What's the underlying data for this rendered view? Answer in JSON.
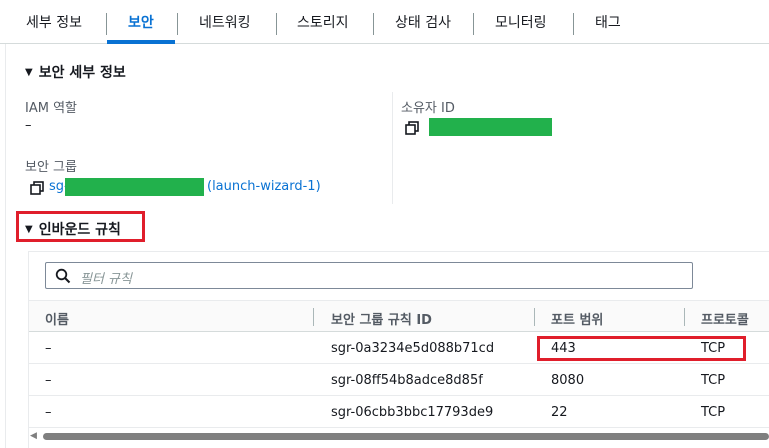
{
  "tabs": [
    {
      "label": "세부 정보"
    },
    {
      "label": "보안"
    },
    {
      "label": "네트워킹"
    },
    {
      "label": "스토리지"
    },
    {
      "label": "상태 검사"
    },
    {
      "label": "모니터링"
    },
    {
      "label": "태그"
    }
  ],
  "active_tab": "보안",
  "security_details": {
    "title": "보안 세부 정보",
    "iam_role_label": "IAM 역할",
    "iam_role_value": "–",
    "owner_id_label": "소유자 ID",
    "security_groups_label": "보안 그룹",
    "security_group_prefix": "sg-",
    "security_group_name": "(launch-wizard-1)"
  },
  "inbound": {
    "title": "인바운드 규칙",
    "search_placeholder": "필터 규칙",
    "columns": [
      "이름",
      "보안 그룹 규칙 ID",
      "포트 범위",
      "프로토콜"
    ],
    "rows": [
      {
        "name": "–",
        "rule_id": "sgr-0a3234e5d088b71cd",
        "port": "443",
        "protocol": "TCP"
      },
      {
        "name": "–",
        "rule_id": "sgr-08ff54b8adce8d85f",
        "port": "8080",
        "protocol": "TCP"
      },
      {
        "name": "–",
        "rule_id": "sgr-06cbb3bbc17793de9",
        "port": "22",
        "protocol": "TCP"
      }
    ]
  },
  "colors": {
    "accent": "#0972d3",
    "highlight": "#e01e2b",
    "redaction": "#22b14c"
  }
}
